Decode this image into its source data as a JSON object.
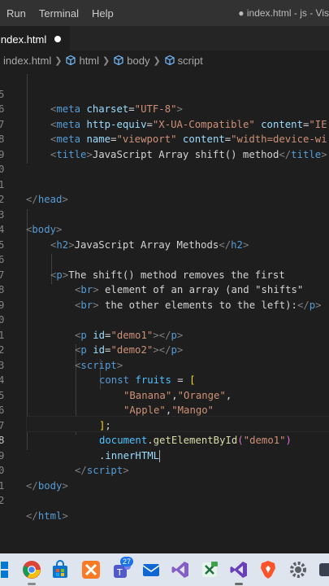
{
  "menubar": {
    "items": [
      "Run",
      "Terminal",
      "Help"
    ],
    "title": "● index.html - js - Vis"
  },
  "tab": {
    "label": "index.html"
  },
  "breadcrumbs": [
    "index.html",
    "html",
    "body",
    "script"
  ],
  "editor": {
    "lines": [
      {
        "n": "5"
      },
      {
        "n": "6"
      },
      {
        "n": "7"
      },
      {
        "n": "8"
      },
      {
        "n": "9"
      },
      {
        "n": "0"
      },
      {
        "n": "1"
      },
      {
        "n": "2"
      },
      {
        "n": "3"
      },
      {
        "n": "4"
      },
      {
        "n": "5"
      },
      {
        "n": "6"
      },
      {
        "n": "7"
      },
      {
        "n": "8"
      },
      {
        "n": "9"
      },
      {
        "n": "0"
      },
      {
        "n": "1"
      },
      {
        "n": "2"
      },
      {
        "n": "3"
      },
      {
        "n": "4"
      },
      {
        "n": "5"
      },
      {
        "n": "6"
      },
      {
        "n": "7"
      },
      {
        "n": "8"
      },
      {
        "n": "9"
      },
      {
        "n": "0"
      },
      {
        "n": "1"
      },
      {
        "n": "2"
      }
    ],
    "strings": {
      "meta": "meta",
      "charset_attr": "charset",
      "charset_val": "\"UTF-8\"",
      "httpequiv_attr": "http-equiv",
      "httpequiv_val": "\"X-UA-Compatible\"",
      "content_attr": "content",
      "content_val1": "\"IE",
      "name_attr": "name",
      "name_val": "\"viewport\"",
      "content_val2": "\"width=device-wi",
      "title": "title",
      "title_text": "JavaScript Array shift() method",
      "head": "head",
      "body": "body",
      "h2": "h2",
      "h2_text": "JavaScript Array Methods",
      "p": "p",
      "p_text1": "The shift() method removes the first",
      "br": "br",
      "p_text2": " element of an array (and \"shifts\"",
      "p_text3": " the other elements to the left):",
      "id_attr": "id",
      "demo1": "\"demo1\"",
      "demo2": "\"demo2\"",
      "script": "script",
      "const": "const",
      "fruits": "fruits",
      "eq": " = ",
      "banana": "\"Banana\"",
      "orange": "\"Orange\"",
      "apple": "\"Apple\"",
      "mango": "\"Mango\"",
      "document": "document",
      "getById": "getElementById",
      "demo1_arg": "\"demo1\"",
      "innerHTML": "innerHTML",
      "html": "html"
    }
  },
  "taskbar": {
    "badge": "27",
    "icons": [
      "windows-partial-icon",
      "chrome-icon",
      "store-icon",
      "xampp-icon",
      "teams-icon",
      "mail-icon",
      "visual-studio-icon",
      "excel-icon",
      "vscode-icon",
      "brave-icon",
      "settings-icon",
      "other-icon"
    ],
    "colors": {
      "accent": "#1a73e8"
    }
  }
}
